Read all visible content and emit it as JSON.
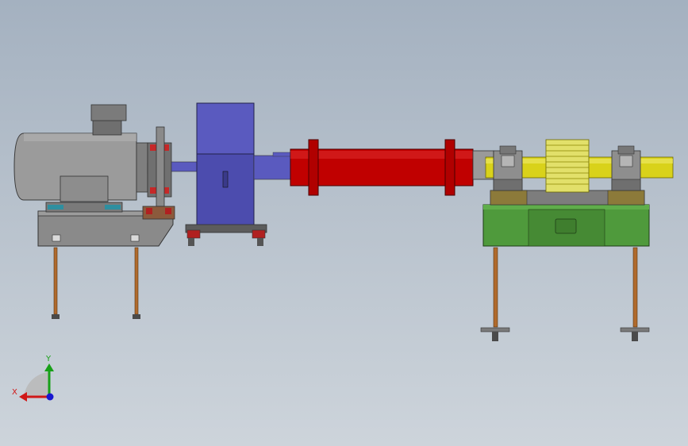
{
  "viewport": {
    "view": "front",
    "colors": {
      "background_top": "#a4b1c0",
      "background_bottom": "#cdd4db",
      "motor_body": "#9b9b9b",
      "motor_frame": "#6f6f6f",
      "coupling_accent": "#c62828",
      "gearbox": "#5a5abf",
      "drum": "#c00000",
      "output_shaft": "#d9d21a",
      "gear": "#e2e06a",
      "base_frame": "#4f9a3c",
      "anchor_bolt": "#b06a2c"
    },
    "components": [
      {
        "name": "electric-motor",
        "icon": "motor-icon"
      },
      {
        "name": "motor-coupling",
        "icon": "coupling-icon"
      },
      {
        "name": "gearbox-housing",
        "icon": "gearbox-icon"
      },
      {
        "name": "drum-cylinder",
        "icon": "cylinder-icon"
      },
      {
        "name": "bearing-blocks",
        "icon": "bearing-icon"
      },
      {
        "name": "spur-gear",
        "icon": "gear-icon"
      },
      {
        "name": "green-base-frame",
        "icon": "frame-icon"
      }
    ]
  },
  "triad": {
    "x_label": "X",
    "y_label": "Y",
    "x_color": "#d01818",
    "y_color": "#18a018",
    "z_color": "#1818d0"
  }
}
